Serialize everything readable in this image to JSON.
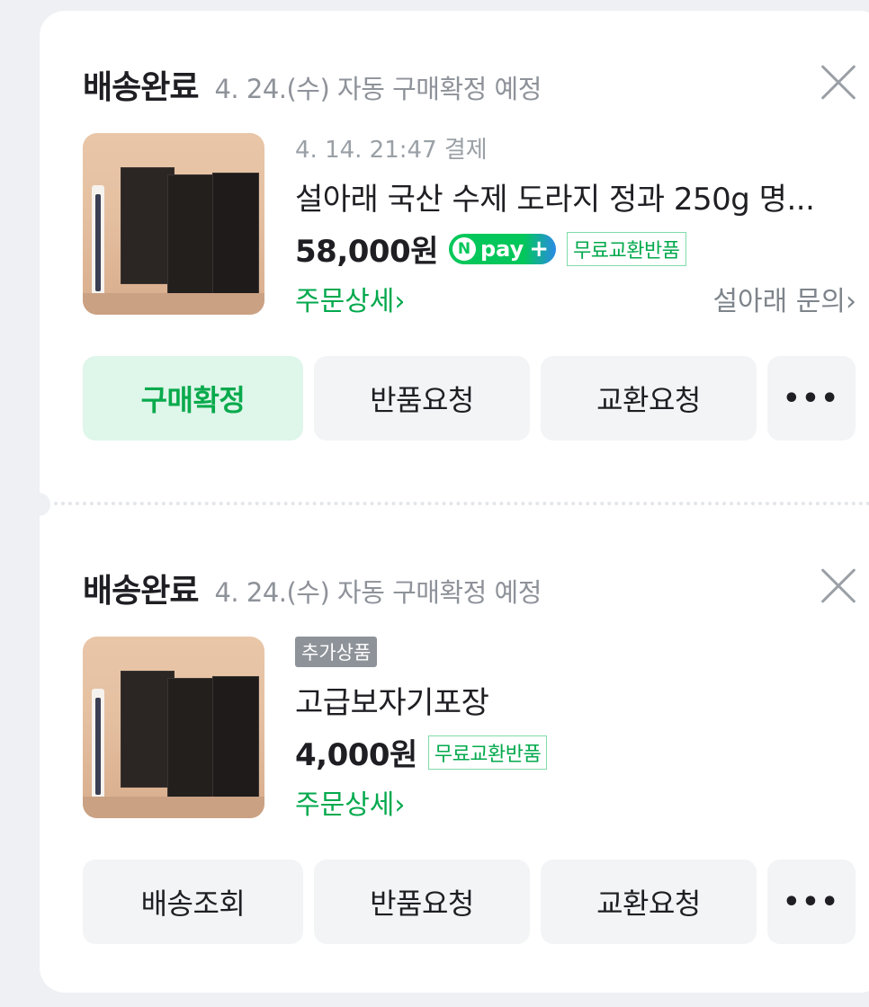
{
  "orders": [
    {
      "status": "배송완료",
      "status_note": "4. 24.(수) 자동 구매확정 예정",
      "paid_at": "4. 14. 21:47 결제",
      "product_name": "설아래 국산 수제 도라지 정과 250g 명...",
      "price": "58,000원",
      "payment_badge": "pay",
      "return_tag": "무료교환반품",
      "detail_link": "주문상세",
      "inquiry_link": "설아래 문의",
      "buttons": [
        "구매확정",
        "반품요청",
        "교환요청"
      ]
    },
    {
      "status": "배송완료",
      "status_note": "4. 24.(수) 자동 구매확정 예정",
      "extra_badge": "추가상품",
      "product_name": "고급보자기포장",
      "price": "4,000원",
      "return_tag": "무료교환반품",
      "detail_link": "주문상세",
      "buttons": [
        "배송조회",
        "반품요청",
        "교환요청"
      ]
    }
  ],
  "icons": {
    "close": "close-icon",
    "more": "more-icon",
    "chevron": "chevron-right-icon"
  },
  "colors": {
    "accent_green": "#03a94d",
    "primary_button_bg": "#dff6ea"
  }
}
